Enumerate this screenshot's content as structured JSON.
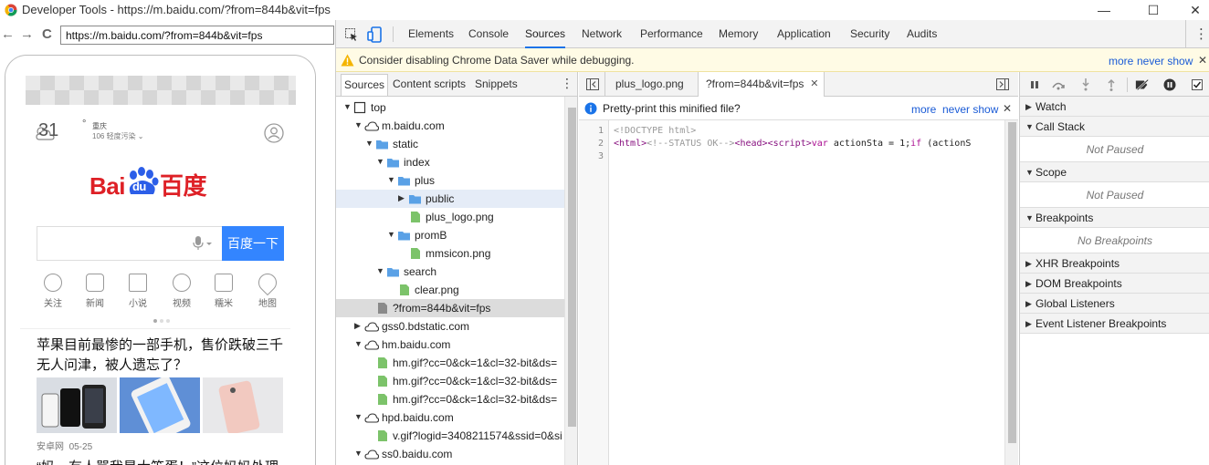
{
  "window": {
    "title": "Developer Tools - https://m.baidu.com/?from=844b&vit=fps",
    "minimize_glyph": "—",
    "maximize_glyph": "☐",
    "close_glyph": "✕"
  },
  "browser": {
    "back_glyph": "←",
    "forward_glyph": "→",
    "reload_glyph": "C",
    "url": "https://m.baidu.com/?from=844b&vit=fps"
  },
  "page": {
    "weather": {
      "temp": "31",
      "degree": "°",
      "city": "重庆",
      "aqi": "106 轻度污染"
    },
    "logo_text": "Bai",
    "logo_du": "du",
    "logo_cn": "百度",
    "search_button": "百度一下",
    "quick_links": [
      {
        "label": "关注"
      },
      {
        "label": "新闻"
      },
      {
        "label": "小说"
      },
      {
        "label": "视频"
      },
      {
        "label": "糯米"
      },
      {
        "label": "地图"
      }
    ],
    "news": [
      {
        "title": "苹果目前最惨的一部手机，售价跌破三千无人问津，被人遗忘了？",
        "source": "安卓网",
        "date": "05-25"
      },
      {
        "title": "“妈，有人骂我是大笨蛋！”这位妈妈处理"
      }
    ]
  },
  "devtools": {
    "tabs": [
      "Elements",
      "Console",
      "Sources",
      "Network",
      "Performance",
      "Memory",
      "Application",
      "Security",
      "Audits"
    ],
    "active_tab": "Sources",
    "menu_glyph": "⋮",
    "warning": {
      "message": "Consider disabling Chrome Data Saver while debugging.",
      "more": "more",
      "never_show": "never show",
      "close": "✕"
    },
    "navigator": {
      "tabs": [
        "Sources",
        "Content scripts",
        "Snippets"
      ],
      "menu_glyph": "⋮",
      "tree": [
        {
          "label": "top",
          "depth": 0,
          "expanded": true,
          "kind": "frame"
        },
        {
          "label": "m.baidu.com",
          "depth": 1,
          "expanded": true,
          "kind": "domain"
        },
        {
          "label": "static",
          "depth": 2,
          "expanded": true,
          "kind": "folder"
        },
        {
          "label": "index",
          "depth": 3,
          "expanded": true,
          "kind": "folder"
        },
        {
          "label": "plus",
          "depth": 4,
          "expanded": true,
          "kind": "folder"
        },
        {
          "label": "public",
          "depth": 5,
          "expanded": false,
          "kind": "folder",
          "state": "hover"
        },
        {
          "label": "plus_logo.png",
          "depth": 5,
          "kind": "file"
        },
        {
          "label": "promB",
          "depth": 4,
          "expanded": true,
          "kind": "folder"
        },
        {
          "label": "mmsicon.png",
          "depth": 5,
          "kind": "file"
        },
        {
          "label": "search",
          "depth": 3,
          "expanded": true,
          "kind": "folder"
        },
        {
          "label": "clear.png",
          "depth": 4,
          "kind": "file"
        },
        {
          "label": "?from=844b&vit=fps",
          "depth": 2,
          "kind": "doc",
          "state": "selected"
        },
        {
          "label": "gss0.bdstatic.com",
          "depth": 1,
          "expanded": false,
          "kind": "domain"
        },
        {
          "label": "hm.baidu.com",
          "depth": 1,
          "expanded": true,
          "kind": "domain"
        },
        {
          "label": "hm.gif?cc=0&ck=1&cl=32-bit&ds=",
          "depth": 2,
          "kind": "file"
        },
        {
          "label": "hm.gif?cc=0&ck=1&cl=32-bit&ds=",
          "depth": 2,
          "kind": "file"
        },
        {
          "label": "hm.gif?cc=0&ck=1&cl=32-bit&ds=",
          "depth": 2,
          "kind": "file"
        },
        {
          "label": "hpd.baidu.com",
          "depth": 1,
          "expanded": true,
          "kind": "domain"
        },
        {
          "label": "v.gif?logid=3408211574&ssid=0&si",
          "depth": 2,
          "kind": "file"
        },
        {
          "label": "ss0.baidu.com",
          "depth": 1,
          "expanded": true,
          "kind": "domain"
        }
      ]
    },
    "editor": {
      "tabs": [
        {
          "label": "plus_logo.png",
          "active": false
        },
        {
          "label": "?from=844b&vit=fps",
          "active": true,
          "close": "✕"
        }
      ],
      "infobar": {
        "message": "Pretty-print this minified file?",
        "more": "more",
        "never_show": "never show",
        "close": "✕"
      },
      "lines": [
        {
          "num": "1",
          "parts": [
            {
              "t": "<!DOCTYPE html>",
              "c": "c-comment"
            }
          ]
        },
        {
          "num": "2",
          "parts": [
            {
              "t": "<html>",
              "c": "c-tag"
            },
            {
              "t": "<!--STATUS OK-->",
              "c": "c-comment"
            },
            {
              "t": "<head>",
              "c": "c-tag"
            },
            {
              "t": "<script>",
              "c": "c-tag"
            },
            {
              "t": "var",
              "c": "c-kw"
            },
            {
              "t": " actionSta = 1;",
              "c": ""
            },
            {
              "t": "if",
              "c": "c-kw"
            },
            {
              "t": " (actionS",
              "c": ""
            }
          ]
        },
        {
          "num": "3",
          "parts": []
        }
      ]
    },
    "debugger": {
      "sections": [
        {
          "label": "Watch",
          "body": null
        },
        {
          "label": "Call Stack",
          "body": "Not Paused"
        },
        {
          "label": "Scope",
          "body": "Not Paused"
        },
        {
          "label": "Breakpoints",
          "body": "No Breakpoints"
        },
        {
          "label": "XHR Breakpoints",
          "body": null
        },
        {
          "label": "DOM Breakpoints",
          "body": null
        },
        {
          "label": "Global Listeners",
          "body": null
        },
        {
          "label": "Event Listener Breakpoints",
          "body": null
        }
      ]
    }
  }
}
